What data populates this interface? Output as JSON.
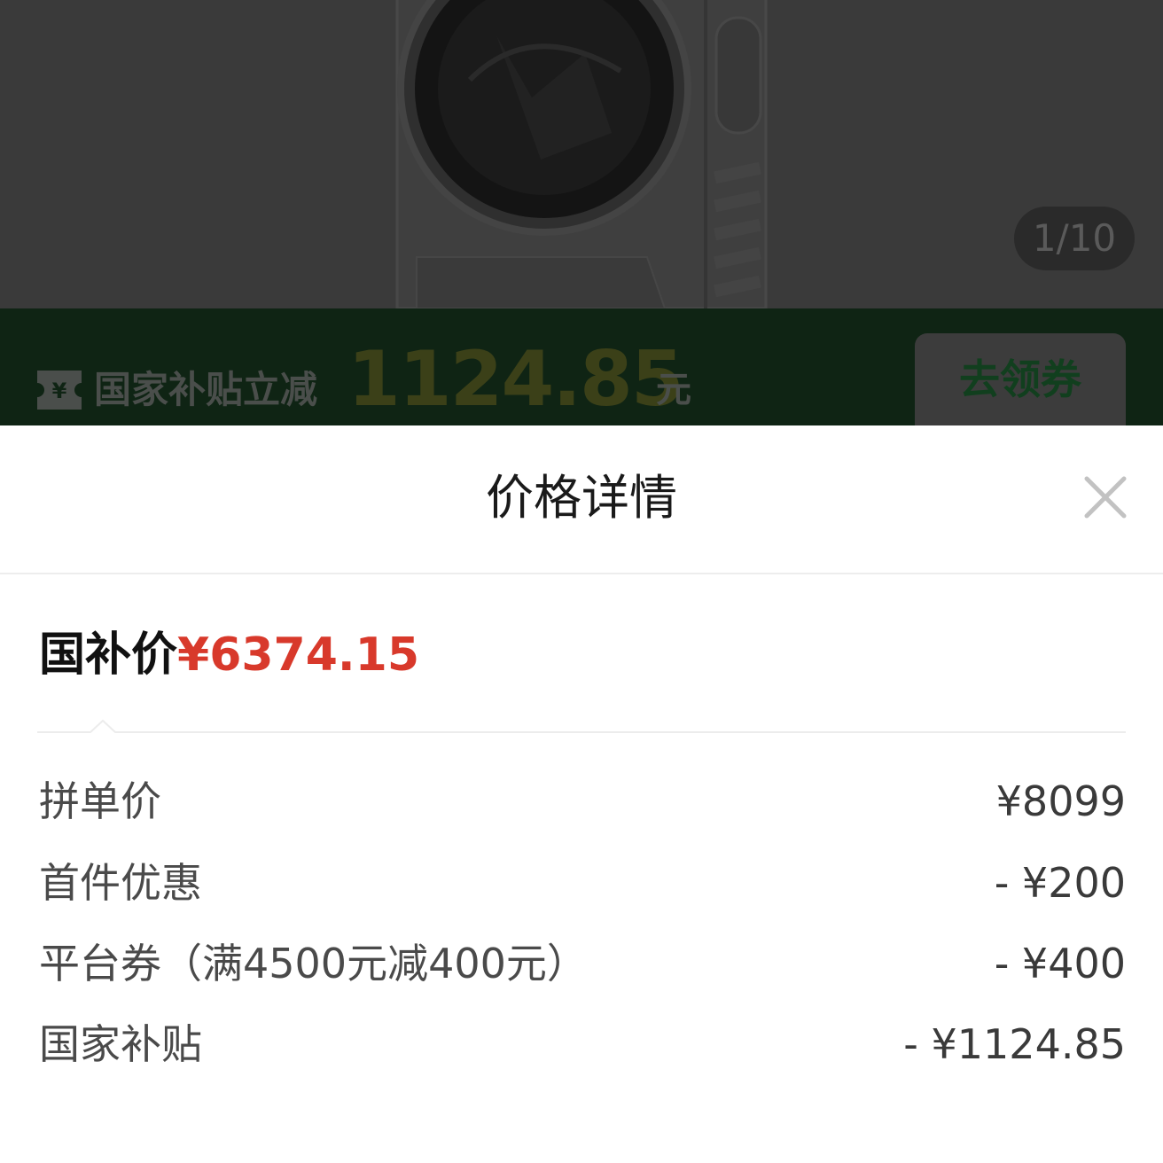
{
  "product": {
    "image_icon": "washing-machine-image",
    "page_counter": "1/10"
  },
  "banner": {
    "ticket_icon": "yen-ticket-icon",
    "ticket_symbol": "¥",
    "label": "国家补贴立减",
    "amount": "1124.85",
    "unit": "元",
    "coupon_button": "去领券",
    "background_color": "#0f2414"
  },
  "sheet": {
    "title": "价格详情",
    "close_icon": "close-icon",
    "final_price_label": "国补价",
    "final_price_value": "¥6374.15",
    "accent_color": "#d8392b",
    "breakdown": [
      {
        "label": "拼单价",
        "value": "¥8099"
      },
      {
        "label": "首件优惠",
        "value": "- ¥200"
      },
      {
        "label": "平台券（满4500元减400元）",
        "value": "- ¥400"
      },
      {
        "label": "国家补贴",
        "value": "- ¥1124.85"
      }
    ]
  }
}
